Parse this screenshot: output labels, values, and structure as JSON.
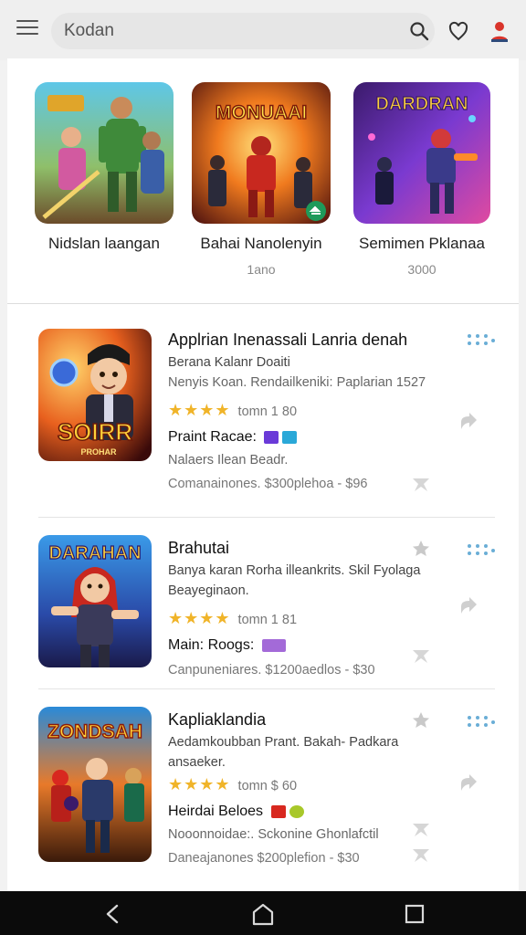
{
  "search": {
    "value": "Kodan"
  },
  "featured": [
    {
      "name": "Nidslan laangan",
      "sub": "",
      "art_title": ""
    },
    {
      "name": "Bahai Nanolenyin",
      "sub": "1ano",
      "art_title": "MONUAAI"
    },
    {
      "name": "Semimen Pklanaa",
      "sub": "3000",
      "art_title": "DARDRAN"
    }
  ],
  "apps": [
    {
      "title": "Applrian Inenassali Lanria denah",
      "line1": "Berana Kalanr Doaiti",
      "line2": "Nenyis Koan. Rendailkeniki: Paplarian 1527",
      "stars": "★★★★",
      "rating_text": "tomn 1 80",
      "tag": "Praint Racae:",
      "line3": "Nalaers Ilean Beadr.",
      "price": "Comanainones. $300plehoa - $96",
      "art_title": "SOIRR",
      "art_sub": "PROHAR"
    },
    {
      "title": "Brahutai",
      "line1": "Banya karan Rorha illeankrits. Skil Fyolaga",
      "line2": "Beayeginaon.",
      "stars": "★★★★",
      "rating_text": "tomn 1 81",
      "tag": "Main: Roogs:",
      "line3": "",
      "price": "Canpuneniares. $1200aedlos - $30",
      "art_title": "DARAHAN",
      "art_sub": ""
    },
    {
      "title": "Kapliaklandia",
      "line1": "Aedamkoubban Prant. Bakah- Padkara",
      "line2": "ansaeker.",
      "stars": "★★★★",
      "rating_text": "tomn $ 60",
      "tag": "Heirdai Beloes",
      "line3": "Nooonnoidae:. Sckonine Ghonlafctil",
      "price": "Daneajanones $200plefion - $30",
      "art_title": "ZONDSAH",
      "art_sub": ""
    }
  ],
  "colors": {
    "accent_star": "#f0b429",
    "dots_blue": "#6aaed6",
    "nav_bg": "#0b0b0b"
  }
}
